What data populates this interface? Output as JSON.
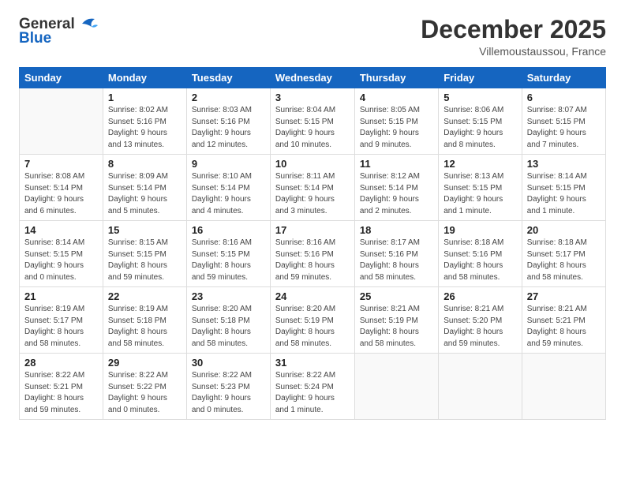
{
  "header": {
    "logo_general": "General",
    "logo_blue": "Blue",
    "month_title": "December 2025",
    "location": "Villemoustaussou, France"
  },
  "calendar": {
    "days_of_week": [
      "Sunday",
      "Monday",
      "Tuesday",
      "Wednesday",
      "Thursday",
      "Friday",
      "Saturday"
    ],
    "weeks": [
      [
        {
          "day": "",
          "info": ""
        },
        {
          "day": "1",
          "info": "Sunrise: 8:02 AM\nSunset: 5:16 PM\nDaylight: 9 hours\nand 13 minutes."
        },
        {
          "day": "2",
          "info": "Sunrise: 8:03 AM\nSunset: 5:16 PM\nDaylight: 9 hours\nand 12 minutes."
        },
        {
          "day": "3",
          "info": "Sunrise: 8:04 AM\nSunset: 5:15 PM\nDaylight: 9 hours\nand 10 minutes."
        },
        {
          "day": "4",
          "info": "Sunrise: 8:05 AM\nSunset: 5:15 PM\nDaylight: 9 hours\nand 9 minutes."
        },
        {
          "day": "5",
          "info": "Sunrise: 8:06 AM\nSunset: 5:15 PM\nDaylight: 9 hours\nand 8 minutes."
        },
        {
          "day": "6",
          "info": "Sunrise: 8:07 AM\nSunset: 5:15 PM\nDaylight: 9 hours\nand 7 minutes."
        }
      ],
      [
        {
          "day": "7",
          "info": "Sunrise: 8:08 AM\nSunset: 5:14 PM\nDaylight: 9 hours\nand 6 minutes."
        },
        {
          "day": "8",
          "info": "Sunrise: 8:09 AM\nSunset: 5:14 PM\nDaylight: 9 hours\nand 5 minutes."
        },
        {
          "day": "9",
          "info": "Sunrise: 8:10 AM\nSunset: 5:14 PM\nDaylight: 9 hours\nand 4 minutes."
        },
        {
          "day": "10",
          "info": "Sunrise: 8:11 AM\nSunset: 5:14 PM\nDaylight: 9 hours\nand 3 minutes."
        },
        {
          "day": "11",
          "info": "Sunrise: 8:12 AM\nSunset: 5:14 PM\nDaylight: 9 hours\nand 2 minutes."
        },
        {
          "day": "12",
          "info": "Sunrise: 8:13 AM\nSunset: 5:15 PM\nDaylight: 9 hours\nand 1 minute."
        },
        {
          "day": "13",
          "info": "Sunrise: 8:14 AM\nSunset: 5:15 PM\nDaylight: 9 hours\nand 1 minute."
        }
      ],
      [
        {
          "day": "14",
          "info": "Sunrise: 8:14 AM\nSunset: 5:15 PM\nDaylight: 9 hours\nand 0 minutes."
        },
        {
          "day": "15",
          "info": "Sunrise: 8:15 AM\nSunset: 5:15 PM\nDaylight: 8 hours\nand 59 minutes."
        },
        {
          "day": "16",
          "info": "Sunrise: 8:16 AM\nSunset: 5:15 PM\nDaylight: 8 hours\nand 59 minutes."
        },
        {
          "day": "17",
          "info": "Sunrise: 8:16 AM\nSunset: 5:16 PM\nDaylight: 8 hours\nand 59 minutes."
        },
        {
          "day": "18",
          "info": "Sunrise: 8:17 AM\nSunset: 5:16 PM\nDaylight: 8 hours\nand 58 minutes."
        },
        {
          "day": "19",
          "info": "Sunrise: 8:18 AM\nSunset: 5:16 PM\nDaylight: 8 hours\nand 58 minutes."
        },
        {
          "day": "20",
          "info": "Sunrise: 8:18 AM\nSunset: 5:17 PM\nDaylight: 8 hours\nand 58 minutes."
        }
      ],
      [
        {
          "day": "21",
          "info": "Sunrise: 8:19 AM\nSunset: 5:17 PM\nDaylight: 8 hours\nand 58 minutes."
        },
        {
          "day": "22",
          "info": "Sunrise: 8:19 AM\nSunset: 5:18 PM\nDaylight: 8 hours\nand 58 minutes."
        },
        {
          "day": "23",
          "info": "Sunrise: 8:20 AM\nSunset: 5:18 PM\nDaylight: 8 hours\nand 58 minutes."
        },
        {
          "day": "24",
          "info": "Sunrise: 8:20 AM\nSunset: 5:19 PM\nDaylight: 8 hours\nand 58 minutes."
        },
        {
          "day": "25",
          "info": "Sunrise: 8:21 AM\nSunset: 5:19 PM\nDaylight: 8 hours\nand 58 minutes."
        },
        {
          "day": "26",
          "info": "Sunrise: 8:21 AM\nSunset: 5:20 PM\nDaylight: 8 hours\nand 59 minutes."
        },
        {
          "day": "27",
          "info": "Sunrise: 8:21 AM\nSunset: 5:21 PM\nDaylight: 8 hours\nand 59 minutes."
        }
      ],
      [
        {
          "day": "28",
          "info": "Sunrise: 8:22 AM\nSunset: 5:21 PM\nDaylight: 8 hours\nand 59 minutes."
        },
        {
          "day": "29",
          "info": "Sunrise: 8:22 AM\nSunset: 5:22 PM\nDaylight: 9 hours\nand 0 minutes."
        },
        {
          "day": "30",
          "info": "Sunrise: 8:22 AM\nSunset: 5:23 PM\nDaylight: 9 hours\nand 0 minutes."
        },
        {
          "day": "31",
          "info": "Sunrise: 8:22 AM\nSunset: 5:24 PM\nDaylight: 9 hours\nand 1 minute."
        },
        {
          "day": "",
          "info": ""
        },
        {
          "day": "",
          "info": ""
        },
        {
          "day": "",
          "info": ""
        }
      ]
    ]
  }
}
